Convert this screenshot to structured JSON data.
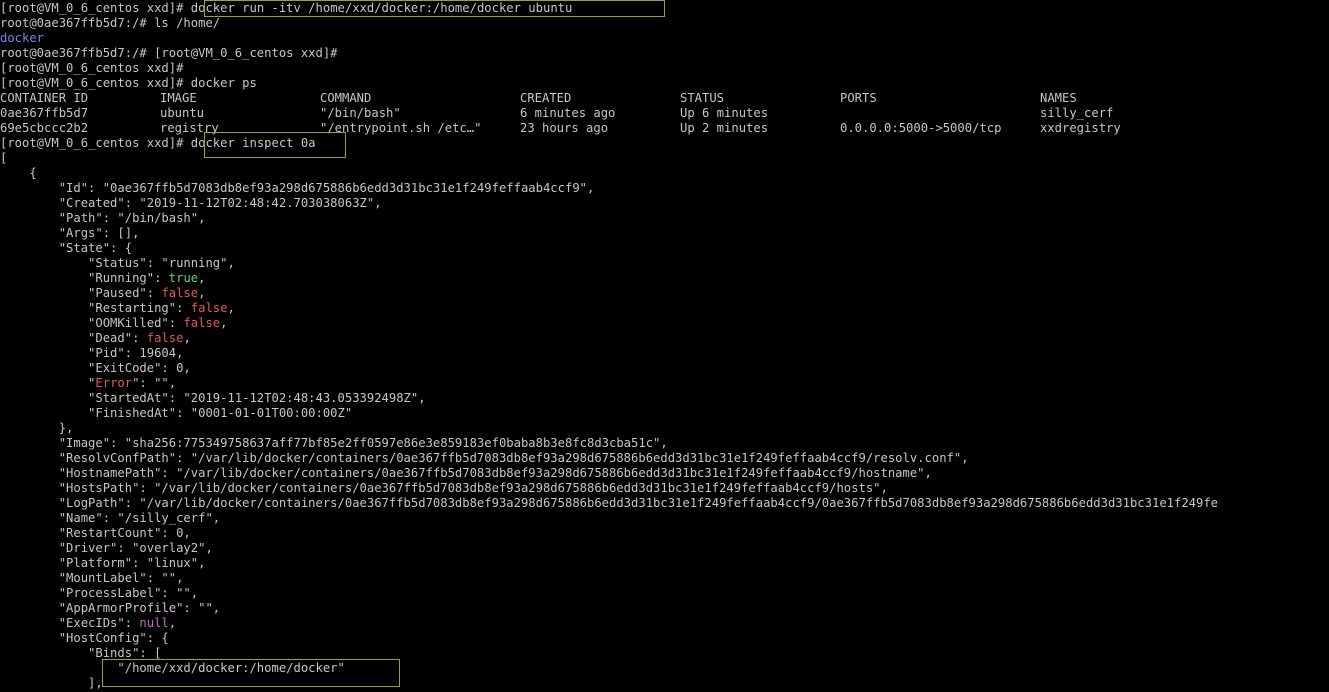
{
  "colors": {
    "background": "#000000",
    "foreground": "#c6c6c6",
    "blue": "#6f86f0",
    "green": "#5fd35f",
    "red": "#e05a5a",
    "magenta": "#d25fd2",
    "highlight_box": "#8fa82a"
  },
  "lines": {
    "l0_prompt": "[root@VM_0_6_centos xxd]# ",
    "l0_cmd": "docker run -itv /home/xxd/docker:/home/docker ubuntu",
    "l1": "root@0ae367ffb5d7:/# ls /home/",
    "l2": "docker",
    "l3": "root@0ae367ffb5d7:/# [root@VM_0_6_centos xxd]#",
    "l4": "[root@VM_0_6_centos xxd]#",
    "l5": "[root@VM_0_6_centos xxd]# docker ps",
    "l8_prompt": "[root@VM_0_6_centos xxd]# ",
    "l8_cmd": "docker inspect 0a",
    "l9": "[",
    "l10": "    {",
    "l11": "        \"Id\": \"0ae367ffb5d7083db8ef93a298d675886b6edd3d31bc31e1f249feffaab4ccf9\",",
    "l12": "        \"Created\": \"2019-11-12T02:48:42.703038063Z\",",
    "l13": "        \"Path\": \"/bin/bash\",",
    "l14": "        \"Args\": [],",
    "l15": "        \"State\": {",
    "l16": "            \"Status\": \"running\",",
    "l17_key": "            \"Running\": ",
    "l17_val": "true",
    "l18_key": "            \"Paused\": ",
    "l18_val": "false",
    "l19_key": "            \"Restarting\": ",
    "l19_val": "false",
    "l20_key": "            \"OOMKilled\": ",
    "l20_val": "false",
    "l21_key": "            \"Dead\": ",
    "l21_val": "false",
    "l22": "            \"Pid\": 19604,",
    "l23": "            \"ExitCode\": 0,",
    "l24_pre": "            \"",
    "l24_key": "Error",
    "l24_post": "\": \"\",",
    "l25": "            \"StartedAt\": \"2019-11-12T02:48:43.053392498Z\",",
    "l26": "            \"FinishedAt\": \"0001-01-01T00:00:00Z\"",
    "l27": "        },",
    "l28": "        \"Image\": \"sha256:775349758637aff77bf85e2ff0597e86e3e859183ef0baba8b3e8fc8d3cba51c\",",
    "l29": "        \"ResolvConfPath\": \"/var/lib/docker/containers/0ae367ffb5d7083db8ef93a298d675886b6edd3d31bc31e1f249feffaab4ccf9/resolv.conf\",",
    "l30": "        \"HostnamePath\": \"/var/lib/docker/containers/0ae367ffb5d7083db8ef93a298d675886b6edd3d31bc31e1f249feffaab4ccf9/hostname\",",
    "l31": "        \"HostsPath\": \"/var/lib/docker/containers/0ae367ffb5d7083db8ef93a298d675886b6edd3d31bc31e1f249feffaab4ccf9/hosts\",",
    "l32": "        \"LogPath\": \"/var/lib/docker/containers/0ae367ffb5d7083db8ef93a298d675886b6edd3d31bc31e1f249feffaab4ccf9/0ae367ffb5d7083db8ef93a298d675886b6edd3d31bc31e1f249fe",
    "l33": "        \"Name\": \"/silly_cerf\",",
    "l34": "        \"RestartCount\": 0,",
    "l35": "        \"Driver\": \"overlay2\",",
    "l36": "        \"Platform\": \"linux\",",
    "l37": "        \"MountLabel\": \"\",",
    "l38": "        \"ProcessLabel\": \"\",",
    "l39": "        \"AppArmorProfile\": \"\",",
    "l40_key": "        \"ExecIDs\": ",
    "l40_val": "null",
    "l40_post": ",",
    "l41": "        \"HostConfig\": {",
    "l42": "            \"Binds\": [",
    "l43": "                \"/home/xxd/docker:/home/docker\"",
    "l44": "            ],"
  },
  "ps_table": {
    "headers": [
      "CONTAINER ID",
      "IMAGE",
      "COMMAND",
      "CREATED",
      "STATUS",
      "PORTS",
      "NAMES"
    ],
    "rows": [
      [
        "0ae367ffb5d7",
        "ubuntu",
        "\"/bin/bash\"",
        "6 minutes ago",
        "Up 6 minutes",
        "",
        "silly_cerf"
      ],
      [
        "69e5cbccc2b2",
        "registry",
        "\"/entrypoint.sh /etc…\"",
        "23 hours ago",
        "Up 2 minutes",
        "0.0.0.0:5000->5000/tcp",
        "xxdregistry"
      ]
    ]
  }
}
